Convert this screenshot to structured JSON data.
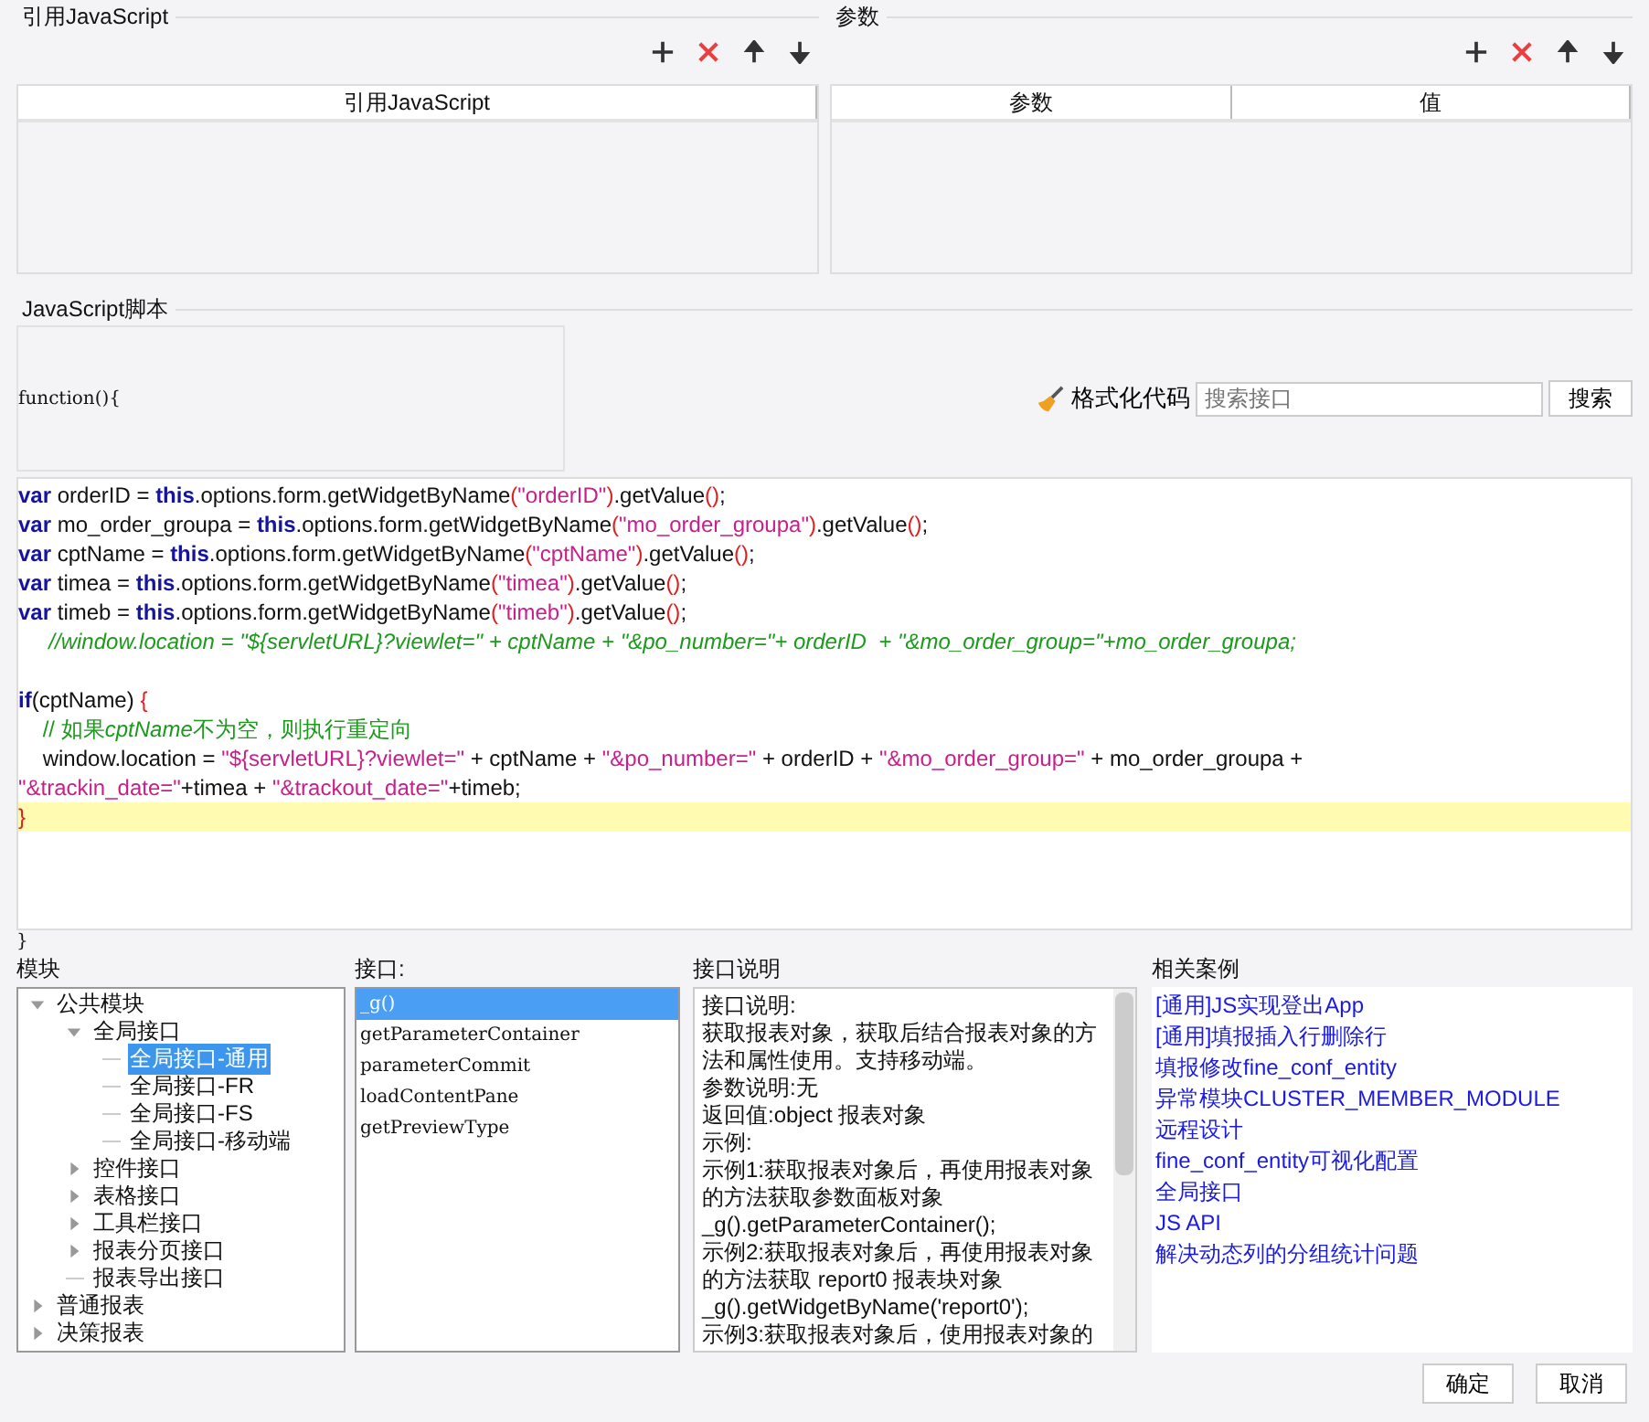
{
  "references": {
    "title": "引用JavaScript",
    "columns": [
      "引用JavaScript"
    ]
  },
  "parameters": {
    "title": "参数",
    "columns": [
      "参数",
      "值"
    ]
  },
  "script": {
    "title": "JavaScript脚本",
    "header": "function(){",
    "format_button": "格式化代码",
    "search": {
      "placeholder": "搜索接口"
    },
    "search_button": "搜索",
    "footer": "}",
    "lines": [
      {
        "current": false,
        "tokens": [
          {
            "kind": "kw",
            "text": "var"
          },
          {
            "kind": "plain",
            "text": " orderID = "
          },
          {
            "kind": "kw",
            "text": "this"
          },
          {
            "kind": "plain",
            "text": ".options.form.getWidgetByName"
          },
          {
            "kind": "paren",
            "text": "("
          },
          {
            "kind": "str",
            "text": "\"orderID\""
          },
          {
            "kind": "paren",
            "text": ")"
          },
          {
            "kind": "plain",
            "text": ".getValue"
          },
          {
            "kind": "paren",
            "text": "()"
          },
          {
            "kind": "plain",
            "text": ";"
          }
        ]
      },
      {
        "current": false,
        "tokens": [
          {
            "kind": "kw",
            "text": "var"
          },
          {
            "kind": "plain",
            "text": " mo_order_groupa = "
          },
          {
            "kind": "kw",
            "text": "this"
          },
          {
            "kind": "plain",
            "text": ".options.form.getWidgetByName"
          },
          {
            "kind": "paren",
            "text": "("
          },
          {
            "kind": "str",
            "text": "\"mo_order_groupa\""
          },
          {
            "kind": "paren",
            "text": ")"
          },
          {
            "kind": "plain",
            "text": ".getValue"
          },
          {
            "kind": "paren",
            "text": "()"
          },
          {
            "kind": "plain",
            "text": ";"
          }
        ]
      },
      {
        "current": false,
        "tokens": [
          {
            "kind": "kw",
            "text": "var"
          },
          {
            "kind": "plain",
            "text": " cptName = "
          },
          {
            "kind": "kw",
            "text": "this"
          },
          {
            "kind": "plain",
            "text": ".options.form.getWidgetByName"
          },
          {
            "kind": "paren",
            "text": "("
          },
          {
            "kind": "str",
            "text": "\"cptName\""
          },
          {
            "kind": "paren",
            "text": ")"
          },
          {
            "kind": "plain",
            "text": ".getValue"
          },
          {
            "kind": "paren",
            "text": "()"
          },
          {
            "kind": "plain",
            "text": ";"
          }
        ]
      },
      {
        "current": false,
        "tokens": [
          {
            "kind": "kw",
            "text": "var"
          },
          {
            "kind": "plain",
            "text": " timea = "
          },
          {
            "kind": "kw",
            "text": "this"
          },
          {
            "kind": "plain",
            "text": ".options.form.getWidgetByName"
          },
          {
            "kind": "paren",
            "text": "("
          },
          {
            "kind": "str",
            "text": "\"timea\""
          },
          {
            "kind": "paren",
            "text": ")"
          },
          {
            "kind": "plain",
            "text": ".getValue"
          },
          {
            "kind": "paren",
            "text": "()"
          },
          {
            "kind": "plain",
            "text": ";"
          }
        ]
      },
      {
        "current": false,
        "tokens": [
          {
            "kind": "kw",
            "text": "var"
          },
          {
            "kind": "plain",
            "text": " timeb = "
          },
          {
            "kind": "kw",
            "text": "this"
          },
          {
            "kind": "plain",
            "text": ".options.form.getWidgetByName"
          },
          {
            "kind": "paren",
            "text": "("
          },
          {
            "kind": "str",
            "text": "\"timeb\""
          },
          {
            "kind": "paren",
            "text": ")"
          },
          {
            "kind": "plain",
            "text": ".getValue"
          },
          {
            "kind": "paren",
            "text": "()"
          },
          {
            "kind": "plain",
            "text": ";"
          }
        ]
      },
      {
        "current": false,
        "tokens": [
          {
            "kind": "comment",
            "text": "     //window.location = \"${servletURL}?viewlet=\" + cptName + \"&po_number=\"+ orderID  + \"&mo_order_group=\"+mo_order_groupa;"
          }
        ]
      },
      {
        "current": false
      },
      {
        "current": false,
        "tokens": [
          {
            "kind": "kw",
            "text": "if"
          },
          {
            "kind": "plain",
            "text": "(cptName) "
          },
          {
            "kind": "paren",
            "text": "{"
          }
        ]
      },
      {
        "current": false,
        "tokens": [
          {
            "kind": "note",
            "text": "    // 如果"
          },
          {
            "kind": "comment",
            "text": "cptName"
          },
          {
            "kind": "note",
            "text": "不为空，则执行重定向"
          }
        ]
      },
      {
        "current": false,
        "tokens": [
          {
            "kind": "plain",
            "text": "    window.location = "
          },
          {
            "kind": "str",
            "text": "\"${servletURL}?viewlet=\""
          },
          {
            "kind": "plain",
            "text": " + cptName + "
          },
          {
            "kind": "str",
            "text": "\"&po_number=\""
          },
          {
            "kind": "plain",
            "text": " + orderID + "
          },
          {
            "kind": "str",
            "text": "\"&mo_order_group=\""
          },
          {
            "kind": "plain",
            "text": " + mo_order_groupa +"
          }
        ]
      },
      {
        "current": false,
        "tokens": [
          {
            "kind": "str",
            "text": "\"&trackin_date=\""
          },
          {
            "kind": "plain",
            "text": "+timea + "
          },
          {
            "kind": "str",
            "text": "\"&trackout_date=\""
          },
          {
            "kind": "plain",
            "text": "+timeb;"
          }
        ]
      },
      {
        "current": true,
        "tokens": [
          {
            "kind": "paren",
            "text": "}"
          }
        ]
      }
    ]
  },
  "modules": {
    "title": "模块",
    "tree": [
      {
        "label": "公共模块",
        "expanded": true,
        "selected": false,
        "children": [
          {
            "label": "全局接口",
            "expanded": true,
            "selected": false,
            "children": [
              {
                "label": "全局接口-通用",
                "selected": true
              },
              {
                "label": "全局接口-FR",
                "selected": false
              },
              {
                "label": "全局接口-FS",
                "selected": false
              },
              {
                "label": "全局接口-移动端",
                "selected": false
              }
            ]
          },
          {
            "label": "控件接口",
            "expanded": false,
            "selected": false
          },
          {
            "label": "表格接口",
            "expanded": false,
            "selected": false
          },
          {
            "label": "工具栏接口",
            "expanded": false,
            "selected": false
          },
          {
            "label": "报表分页接口",
            "expanded": false,
            "selected": false
          },
          {
            "label": "报表导出接口",
            "selected": false
          }
        ]
      },
      {
        "label": "普通报表",
        "expanded": false,
        "selected": false
      },
      {
        "label": "决策报表",
        "expanded": false,
        "selected": false
      }
    ]
  },
  "interfaces": {
    "title": "接口:",
    "items": [
      {
        "label": "_g()",
        "selected": true
      },
      {
        "label": "getParameterContainer",
        "selected": false
      },
      {
        "label": "parameterCommit",
        "selected": false
      },
      {
        "label": "loadContentPane",
        "selected": false
      },
      {
        "label": "getPreviewType",
        "selected": false
      }
    ]
  },
  "description": {
    "title": "接口说明",
    "lines": [
      "接口说明:",
      "获取报表对象，获取后结合报表对象的方法和属性使用。支持移动端。",
      "参数说明:无",
      "返回值:object 报表对象",
      "示例:",
      "示例1:获取报表对象后，再使用报表对象的方法获取参数面板对象",
      "_g().getParameterContainer();",
      "示例2:获取报表对象后，再使用报表对象的方法获取 report0 报表块对象",
      "_g().getWidgetByName('report0');",
      "示例3:获取报表对象后，使用报表对象的"
    ]
  },
  "cases": {
    "title": "相关案例",
    "items": [
      "[通用]JS实现登出App",
      "[通用]填报插入行删除行",
      "填报修改fine_conf_entity",
      "异常模块CLUSTER_MEMBER_MODULE",
      "远程设计",
      "fine_conf_entity可视化配置",
      "全局接口",
      "JS API",
      "解决动态列的分组统计问题"
    ]
  },
  "buttons": [
    "确定",
    "取消"
  ]
}
